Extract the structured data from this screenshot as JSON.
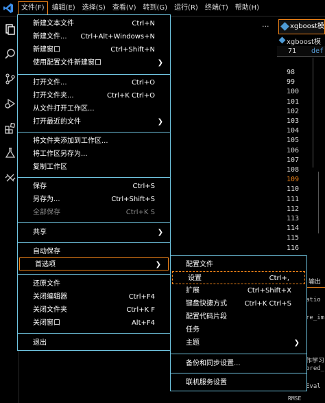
{
  "menubar": {
    "items": [
      "文件(F)",
      "编辑(E)",
      "选择(S)",
      "查看(V)",
      "转到(G)",
      "运行(R)",
      "终端(T)",
      "帮助(H)"
    ]
  },
  "editor": {
    "tab_ellipsis": "···",
    "right_tab_label": "xgboost模",
    "breadcrumb": "xgboost模",
    "sticky_line_number": "71",
    "sticky_keyword": "def",
    "line_numbers": [
      "98",
      "99",
      "100",
      "101",
      "102",
      "103",
      "104",
      "105",
      "106",
      "107",
      "108",
      "109",
      "110",
      "111",
      "112",
      "113",
      "114",
      "115",
      "116"
    ],
    "current_line": "109"
  },
  "panel": {
    "tab_label": "输出",
    "text1": "atio",
    "text2": "re_im",
    "text3": "作学习",
    "text4": "ored_",
    "text5": "Eval",
    "text6": "RMSE"
  },
  "file_menu": {
    "items": [
      {
        "label": "新建文本文件",
        "kb": "Ctrl+N"
      },
      {
        "label": "新建文件...",
        "kb": "Ctrl+Alt+Windows+N"
      },
      {
        "label": "新建窗口",
        "kb": "Ctrl+Shift+N"
      },
      {
        "label": "使用配置文件新建窗口",
        "kb": ""
      },
      {
        "label": "打开文件...",
        "kb": "Ctrl+O"
      },
      {
        "label": "打开文件夹...",
        "kb": "Ctrl+K Ctrl+O"
      },
      {
        "label": "从文件打开工作区...",
        "kb": ""
      },
      {
        "label": "打开最近的文件",
        "kb": ""
      },
      {
        "label": "将文件夹添加到工作区...",
        "kb": ""
      },
      {
        "label": "将工作区另存为...",
        "kb": ""
      },
      {
        "label": "复制工作区",
        "kb": ""
      },
      {
        "label": "保存",
        "kb": "Ctrl+S"
      },
      {
        "label": "另存为...",
        "kb": "Ctrl+Shift+S"
      },
      {
        "label": "全部保存",
        "kb": "Ctrl+K S"
      },
      {
        "label": "共享",
        "kb": ""
      },
      {
        "label": "自动保存",
        "kb": ""
      },
      {
        "label": "首选项",
        "kb": ""
      },
      {
        "label": "还原文件",
        "kb": ""
      },
      {
        "label": "关闭编辑器",
        "kb": "Ctrl+F4"
      },
      {
        "label": "关闭文件夹",
        "kb": "Ctrl+K F"
      },
      {
        "label": "关闭窗口",
        "kb": "Alt+F4"
      },
      {
        "label": "退出",
        "kb": ""
      }
    ]
  },
  "prefs_menu": {
    "items": [
      {
        "label": "配置文件",
        "kb": ""
      },
      {
        "label": "设置",
        "kb": "Ctrl+,"
      },
      {
        "label": "扩展",
        "kb": "Ctrl+Shift+X"
      },
      {
        "label": "键盘快捷方式",
        "kb": "Ctrl+K Ctrl+S"
      },
      {
        "label": "配置代码片段",
        "kb": ""
      },
      {
        "label": "任务",
        "kb": ""
      },
      {
        "label": "主题",
        "kb": ""
      },
      {
        "label": "备份和同步设置...",
        "kb": ""
      },
      {
        "label": "联机服务设置",
        "kb": ""
      }
    ]
  },
  "colors": {
    "accent": "#f38518",
    "menu_border": "#6fc3df",
    "background": "#000000",
    "vscode_blue": "#3b8eea"
  }
}
